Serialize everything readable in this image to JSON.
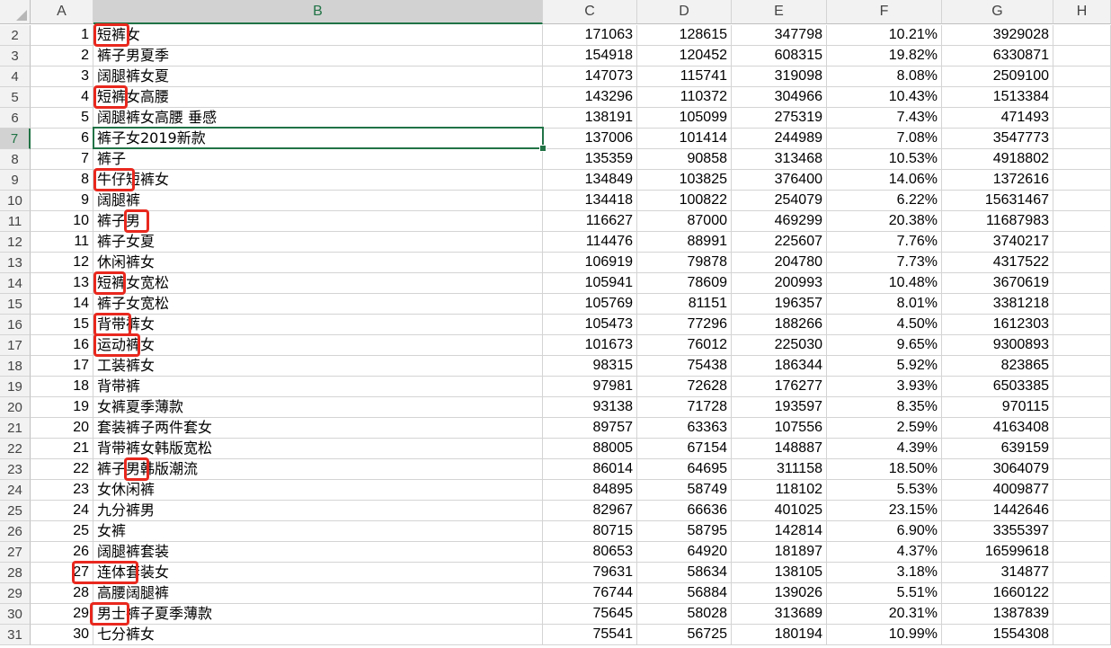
{
  "columns": [
    "A",
    "B",
    "C",
    "D",
    "E",
    "F",
    "G",
    "H"
  ],
  "selected_column": "B",
  "selected_row": "7",
  "rows": [
    {
      "r": "2",
      "a": "1",
      "b": "短裤女",
      "c": "171063",
      "d": "128615",
      "e": "347798",
      "f": "10.21%",
      "g": "3929028"
    },
    {
      "r": "3",
      "a": "2",
      "b": "裤子男夏季",
      "c": "154918",
      "d": "120452",
      "e": "608315",
      "f": "19.82%",
      "g": "6330871"
    },
    {
      "r": "4",
      "a": "3",
      "b": "阔腿裤女夏",
      "c": "147073",
      "d": "115741",
      "e": "319098",
      "f": "8.08%",
      "g": "2509100"
    },
    {
      "r": "5",
      "a": "4",
      "b": "短裤女高腰",
      "c": "143296",
      "d": "110372",
      "e": "304966",
      "f": "10.43%",
      "g": "1513384"
    },
    {
      "r": "6",
      "a": "5",
      "b": "阔腿裤女高腰 垂感",
      "c": "138191",
      "d": "105099",
      "e": "275319",
      "f": "7.43%",
      "g": "471493"
    },
    {
      "r": "7",
      "a": "6",
      "b": "裤子女2019新款",
      "c": "137006",
      "d": "101414",
      "e": "244989",
      "f": "7.08%",
      "g": "3547773"
    },
    {
      "r": "8",
      "a": "7",
      "b": "裤子",
      "c": "135359",
      "d": "90858",
      "e": "313468",
      "f": "10.53%",
      "g": "4918802"
    },
    {
      "r": "9",
      "a": "8",
      "b": "牛仔短裤女",
      "c": "134849",
      "d": "103825",
      "e": "376400",
      "f": "14.06%",
      "g": "1372616"
    },
    {
      "r": "10",
      "a": "9",
      "b": "阔腿裤",
      "c": "134418",
      "d": "100822",
      "e": "254079",
      "f": "6.22%",
      "g": "15631467"
    },
    {
      "r": "11",
      "a": "10",
      "b": "裤子男",
      "c": "116627",
      "d": "87000",
      "e": "469299",
      "f": "20.38%",
      "g": "11687983"
    },
    {
      "r": "12",
      "a": "11",
      "b": "裤子女夏",
      "c": "114476",
      "d": "88991",
      "e": "225607",
      "f": "7.76%",
      "g": "3740217"
    },
    {
      "r": "13",
      "a": "12",
      "b": "休闲裤女",
      "c": "106919",
      "d": "79878",
      "e": "204780",
      "f": "7.73%",
      "g": "4317522"
    },
    {
      "r": "14",
      "a": "13",
      "b": "短裤女宽松",
      "c": "105941",
      "d": "78609",
      "e": "200993",
      "f": "10.48%",
      "g": "3670619"
    },
    {
      "r": "15",
      "a": "14",
      "b": "裤子女宽松",
      "c": "105769",
      "d": "81151",
      "e": "196357",
      "f": "8.01%",
      "g": "3381218"
    },
    {
      "r": "16",
      "a": "15",
      "b": "背带裤女",
      "c": "105473",
      "d": "77296",
      "e": "188266",
      "f": "4.50%",
      "g": "1612303"
    },
    {
      "r": "17",
      "a": "16",
      "b": "运动裤女",
      "c": "101673",
      "d": "76012",
      "e": "225030",
      "f": "9.65%",
      "g": "9300893"
    },
    {
      "r": "18",
      "a": "17",
      "b": "工装裤女",
      "c": "98315",
      "d": "75438",
      "e": "186344",
      "f": "5.92%",
      "g": "823865"
    },
    {
      "r": "19",
      "a": "18",
      "b": "背带裤",
      "c": "97981",
      "d": "72628",
      "e": "176277",
      "f": "3.93%",
      "g": "6503385"
    },
    {
      "r": "20",
      "a": "19",
      "b": "女裤夏季薄款",
      "c": "93138",
      "d": "71728",
      "e": "193597",
      "f": "8.35%",
      "g": "970115"
    },
    {
      "r": "21",
      "a": "20",
      "b": "套装裤子两件套女",
      "c": "89757",
      "d": "63363",
      "e": "107556",
      "f": "2.59%",
      "g": "4163408"
    },
    {
      "r": "22",
      "a": "21",
      "b": "背带裤女韩版宽松",
      "c": "88005",
      "d": "67154",
      "e": "148887",
      "f": "4.39%",
      "g": "639159"
    },
    {
      "r": "23",
      "a": "22",
      "b": "裤子男韩版潮流",
      "c": "86014",
      "d": "64695",
      "e": "311158",
      "f": "18.50%",
      "g": "3064079"
    },
    {
      "r": "24",
      "a": "23",
      "b": "女休闲裤",
      "c": "84895",
      "d": "58749",
      "e": "118102",
      "f": "5.53%",
      "g": "4009877"
    },
    {
      "r": "25",
      "a": "24",
      "b": "九分裤男",
      "c": "82967",
      "d": "66636",
      "e": "401025",
      "f": "23.15%",
      "g": "1442646"
    },
    {
      "r": "26",
      "a": "25",
      "b": "女裤",
      "c": "80715",
      "d": "58795",
      "e": "142814",
      "f": "6.90%",
      "g": "3355397"
    },
    {
      "r": "27",
      "a": "26",
      "b": "阔腿裤套装",
      "c": "80653",
      "d": "64920",
      "e": "181897",
      "f": "4.37%",
      "g": "16599618"
    },
    {
      "r": "28",
      "a": "27",
      "b": "连体套装女",
      "c": "79631",
      "d": "58634",
      "e": "138105",
      "f": "3.18%",
      "g": "314877"
    },
    {
      "r": "29",
      "a": "28",
      "b": "高腰阔腿裤",
      "c": "76744",
      "d": "56884",
      "e": "139026",
      "f": "5.51%",
      "g": "1660122"
    },
    {
      "r": "30",
      "a": "29",
      "b": "男士裤子夏季薄款",
      "c": "75645",
      "d": "58028",
      "e": "313689",
      "f": "20.31%",
      "g": "1387839"
    },
    {
      "r": "31",
      "a": "30",
      "b": "七分裤女",
      "c": "75541",
      "d": "56725",
      "e": "180194",
      "f": "10.99%",
      "g": "1554308"
    }
  ],
  "highlight_color": "#e8281e",
  "accent_color": "#217346"
}
